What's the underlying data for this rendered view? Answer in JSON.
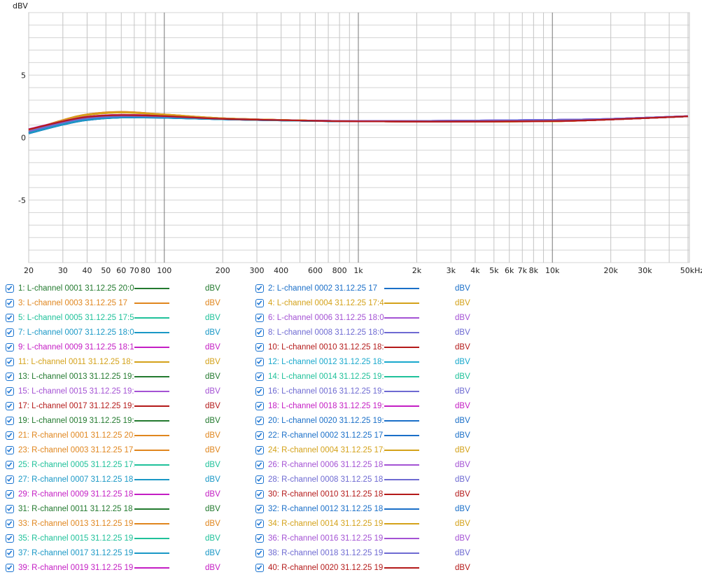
{
  "chart_data": {
    "type": "line",
    "ylabel": "dBV",
    "xunit": "Hz",
    "xscale": "log",
    "xlim": [
      20,
      50000
    ],
    "ylim": [
      -10,
      10
    ],
    "grid": true,
    "x_tick_labels": [
      [
        "20",
        20
      ],
      [
        "30",
        30
      ],
      [
        "40",
        40
      ],
      [
        "50",
        50
      ],
      [
        "60",
        60
      ],
      [
        "70",
        70
      ],
      [
        "80",
        80
      ],
      [
        "100",
        100
      ],
      [
        "200",
        200
      ],
      [
        "300",
        300
      ],
      [
        "400",
        400
      ],
      [
        "600",
        600
      ],
      [
        "800",
        800
      ],
      [
        "1k",
        1000
      ],
      [
        "2k",
        2000
      ],
      [
        "3k",
        3000
      ],
      [
        "4k",
        4000
      ],
      [
        "5k",
        5000
      ],
      [
        "6k",
        6000
      ],
      [
        "7k",
        7000
      ],
      [
        "8k",
        8000
      ],
      [
        "10k",
        10000
      ],
      [
        "20k",
        20000
      ],
      [
        "30k",
        30000
      ],
      [
        "50kHz",
        50000
      ]
    ],
    "y_tick_labels": [
      [
        "5",
        5
      ],
      [
        "0",
        0
      ],
      [
        "-5",
        -5
      ]
    ],
    "x": [
      20,
      30,
      40,
      60,
      100,
      200,
      500,
      1000,
      3000,
      10000,
      20000,
      50000
    ],
    "series": [
      {
        "name": "1: L-channel 0001 31.12.25 20:0",
        "unit": "dBV",
        "color": "#237a2f",
        "values": [
          0.35,
          1.05,
          1.42,
          1.62,
          1.6,
          1.47,
          1.35,
          1.3,
          1.3,
          1.38,
          1.48,
          1.7
        ]
      },
      {
        "name": "2: L-channel 0002 31.12.25 17",
        "unit": "dBV",
        "color": "#1a6fc8",
        "values": [
          0.33,
          1.03,
          1.4,
          1.6,
          1.58,
          1.46,
          1.35,
          1.3,
          1.31,
          1.39,
          1.48,
          1.7
        ]
      },
      {
        "name": "3: L-channel 0003 31.12.25 17",
        "unit": "dBV",
        "color": "#e0861e",
        "values": [
          0.55,
          1.4,
          1.85,
          2.05,
          1.85,
          1.55,
          1.38,
          1.3,
          1.28,
          1.3,
          1.45,
          1.7
        ]
      },
      {
        "name": "4: L-channel 0004 31.12.25 17:4",
        "unit": "dBV",
        "color": "#d4a21a",
        "values": [
          0.52,
          1.37,
          1.8,
          2.0,
          1.82,
          1.54,
          1.38,
          1.3,
          1.28,
          1.31,
          1.45,
          1.7
        ]
      },
      {
        "name": "5: L-channel 0005 31.12.25 17:5",
        "unit": "dBV",
        "color": "#1fc19a",
        "values": [
          0.36,
          1.06,
          1.43,
          1.63,
          1.61,
          1.47,
          1.35,
          1.3,
          1.3,
          1.38,
          1.48,
          1.7
        ]
      },
      {
        "name": "6: L-channel 0006 31.12.25 18:0",
        "unit": "dBV",
        "color": "#a452d4",
        "values": [
          0.5,
          1.2,
          1.55,
          1.72,
          1.68,
          1.5,
          1.37,
          1.32,
          1.35,
          1.42,
          1.5,
          1.72
        ]
      },
      {
        "name": "7: L-channel 0007 31.12.25 18:0",
        "unit": "dBV",
        "color": "#1a98c6",
        "values": [
          0.34,
          1.04,
          1.41,
          1.61,
          1.59,
          1.46,
          1.35,
          1.3,
          1.3,
          1.38,
          1.48,
          1.7
        ]
      },
      {
        "name": "8: L-channel 0008 31.12.25 18:0",
        "unit": "dBV",
        "color": "#6e6ad2",
        "values": [
          0.48,
          1.18,
          1.53,
          1.7,
          1.67,
          1.5,
          1.37,
          1.32,
          1.35,
          1.42,
          1.5,
          1.72
        ]
      },
      {
        "name": "9: L-channel 0009 31.12.25 18:1",
        "unit": "dBV",
        "color": "#c41ec4",
        "values": [
          0.67,
          1.32,
          1.67,
          1.82,
          1.73,
          1.5,
          1.37,
          1.3,
          1.28,
          1.32,
          1.45,
          1.7
        ]
      },
      {
        "name": "10: L-channel 0010 31.12.25 18:",
        "unit": "dBV",
        "color": "#b41a1a",
        "values": [
          0.65,
          1.3,
          1.65,
          1.8,
          1.72,
          1.5,
          1.37,
          1.3,
          1.28,
          1.32,
          1.45,
          1.7
        ]
      },
      {
        "name": "11: L-channel 0011 31.12.25 18:",
        "unit": "dBV",
        "color": "#d4a21a",
        "values": [
          0.53,
          1.38,
          1.82,
          2.02,
          1.83,
          1.54,
          1.38,
          1.3,
          1.28,
          1.31,
          1.45,
          1.7
        ]
      },
      {
        "name": "12: L-channel 0012 31.12.25 18:",
        "unit": "dBV",
        "color": "#18a8cc",
        "values": [
          0.35,
          1.05,
          1.42,
          1.62,
          1.6,
          1.47,
          1.35,
          1.3,
          1.3,
          1.38,
          1.48,
          1.7
        ]
      },
      {
        "name": "13: L-channel 0013 31.12.25 19:",
        "unit": "dBV",
        "color": "#237a2f",
        "values": [
          0.37,
          1.07,
          1.44,
          1.63,
          1.61,
          1.47,
          1.35,
          1.3,
          1.3,
          1.38,
          1.48,
          1.7
        ]
      },
      {
        "name": "14: L-channel 0014 31.12.25 19:",
        "unit": "dBV",
        "color": "#1fc19a",
        "values": [
          0.36,
          1.06,
          1.43,
          1.62,
          1.6,
          1.47,
          1.35,
          1.3,
          1.3,
          1.38,
          1.48,
          1.7
        ]
      },
      {
        "name": "15: L-channel 0015 31.12.25 19:",
        "unit": "dBV",
        "color": "#a452d4",
        "values": [
          0.5,
          1.2,
          1.55,
          1.72,
          1.68,
          1.5,
          1.37,
          1.32,
          1.35,
          1.42,
          1.5,
          1.72
        ]
      },
      {
        "name": "16: L-channel 0016 31.12.25 19:",
        "unit": "dBV",
        "color": "#6e6ad2",
        "values": [
          0.49,
          1.19,
          1.54,
          1.71,
          1.67,
          1.5,
          1.37,
          1.32,
          1.35,
          1.42,
          1.5,
          1.72
        ]
      },
      {
        "name": "17: L-channel 0017 31.12.25 19:",
        "unit": "dBV",
        "color": "#b41a1a",
        "values": [
          0.64,
          1.29,
          1.64,
          1.79,
          1.71,
          1.5,
          1.37,
          1.3,
          1.28,
          1.32,
          1.45,
          1.7
        ]
      },
      {
        "name": "18: L-channel 0018 31.12.25 19:",
        "unit": "dBV",
        "color": "#c41ec4",
        "values": [
          0.66,
          1.31,
          1.66,
          1.81,
          1.72,
          1.5,
          1.37,
          1.3,
          1.28,
          1.32,
          1.45,
          1.7
        ]
      },
      {
        "name": "19: L-channel 0019 31.12.25 19:",
        "unit": "dBV",
        "color": "#237a2f",
        "values": [
          0.36,
          1.06,
          1.43,
          1.62,
          1.6,
          1.47,
          1.35,
          1.3,
          1.3,
          1.38,
          1.48,
          1.7
        ]
      },
      {
        "name": "20: L-channel 0020 31.12.25 19:",
        "unit": "dBV",
        "color": "#1a6fc8",
        "values": [
          0.34,
          1.04,
          1.41,
          1.61,
          1.59,
          1.46,
          1.35,
          1.3,
          1.31,
          1.39,
          1.48,
          1.7
        ]
      },
      {
        "name": "21: R-channel 0001 31.12.25 20:",
        "unit": "dBV",
        "color": "#e0861e",
        "values": [
          0.56,
          1.41,
          1.86,
          2.06,
          1.86,
          1.55,
          1.38,
          1.3,
          1.28,
          1.3,
          1.45,
          1.7
        ]
      },
      {
        "name": "22: R-channel 0002 31.12.25 17",
        "unit": "dBV",
        "color": "#1a6fc8",
        "values": [
          0.33,
          1.03,
          1.4,
          1.6,
          1.58,
          1.46,
          1.35,
          1.3,
          1.31,
          1.39,
          1.48,
          1.7
        ]
      },
      {
        "name": "23: R-channel 0003 31.12.25 17",
        "unit": "dBV",
        "color": "#e0861e",
        "values": [
          0.55,
          1.4,
          1.85,
          2.05,
          1.85,
          1.55,
          1.38,
          1.3,
          1.28,
          1.3,
          1.45,
          1.7
        ]
      },
      {
        "name": "24: R-channel 0004 31.12.25 17:",
        "unit": "dBV",
        "color": "#d4a21a",
        "values": [
          0.52,
          1.37,
          1.8,
          2.0,
          1.82,
          1.54,
          1.38,
          1.3,
          1.28,
          1.31,
          1.45,
          1.7
        ]
      },
      {
        "name": "25: R-channel 0005 31.12.25 17:",
        "unit": "dBV",
        "color": "#1fc19a",
        "values": [
          0.36,
          1.06,
          1.43,
          1.63,
          1.61,
          1.47,
          1.35,
          1.3,
          1.3,
          1.38,
          1.48,
          1.7
        ]
      },
      {
        "name": "26: R-channel 0006 31.12.25 18",
        "unit": "dBV",
        "color": "#a452d4",
        "values": [
          0.5,
          1.2,
          1.55,
          1.72,
          1.68,
          1.5,
          1.37,
          1.32,
          1.35,
          1.42,
          1.5,
          1.72
        ]
      },
      {
        "name": "27: R-channel 0007 31.12.25 18",
        "unit": "dBV",
        "color": "#1a98c6",
        "values": [
          0.34,
          1.04,
          1.41,
          1.61,
          1.59,
          1.46,
          1.35,
          1.3,
          1.3,
          1.38,
          1.48,
          1.7
        ]
      },
      {
        "name": "28: R-channel 0008 31.12.25 18",
        "unit": "dBV",
        "color": "#6e6ad2",
        "values": [
          0.48,
          1.18,
          1.53,
          1.7,
          1.67,
          1.5,
          1.37,
          1.32,
          1.35,
          1.42,
          1.5,
          1.72
        ]
      },
      {
        "name": "29: R-channel 0009 31.12.25 18",
        "unit": "dBV",
        "color": "#c41ec4",
        "values": [
          0.67,
          1.32,
          1.67,
          1.82,
          1.73,
          1.5,
          1.37,
          1.3,
          1.28,
          1.32,
          1.45,
          1.7
        ]
      },
      {
        "name": "30: R-channel 0010 31.12.25 18",
        "unit": "dBV",
        "color": "#b41a1a",
        "values": [
          0.65,
          1.3,
          1.65,
          1.8,
          1.72,
          1.5,
          1.37,
          1.3,
          1.28,
          1.32,
          1.45,
          1.7
        ]
      },
      {
        "name": "31: R-channel 0011 31.12.25 18",
        "unit": "dBV",
        "color": "#237a2f",
        "values": [
          0.35,
          1.05,
          1.42,
          1.62,
          1.6,
          1.47,
          1.35,
          1.3,
          1.3,
          1.38,
          1.48,
          1.7
        ]
      },
      {
        "name": "32: R-channel 0012 31.12.25 18",
        "unit": "dBV",
        "color": "#1a6fc8",
        "values": [
          0.34,
          1.04,
          1.41,
          1.61,
          1.59,
          1.46,
          1.35,
          1.3,
          1.31,
          1.39,
          1.48,
          1.7
        ]
      },
      {
        "name": "33: R-channel 0013 31.12.25 19",
        "unit": "dBV",
        "color": "#e0861e",
        "values": [
          0.54,
          1.39,
          1.84,
          2.04,
          1.84,
          1.55,
          1.38,
          1.3,
          1.28,
          1.3,
          1.45,
          1.7
        ]
      },
      {
        "name": "34: R-channel 0014 31.12.25 19",
        "unit": "dBV",
        "color": "#d4a21a",
        "values": [
          0.53,
          1.38,
          1.82,
          2.02,
          1.83,
          1.54,
          1.38,
          1.3,
          1.28,
          1.31,
          1.45,
          1.7
        ]
      },
      {
        "name": "35: R-channel 0015 31.12.25 19",
        "unit": "dBV",
        "color": "#1fc19a",
        "values": [
          0.36,
          1.06,
          1.43,
          1.62,
          1.6,
          1.47,
          1.35,
          1.3,
          1.3,
          1.38,
          1.48,
          1.7
        ]
      },
      {
        "name": "36: R-channel 0016 31.12.25 19",
        "unit": "dBV",
        "color": "#a452d4",
        "values": [
          0.5,
          1.2,
          1.55,
          1.72,
          1.68,
          1.5,
          1.37,
          1.32,
          1.35,
          1.42,
          1.5,
          1.72
        ]
      },
      {
        "name": "37: R-channel 0017 31.12.25 19",
        "unit": "dBV",
        "color": "#1a98c6",
        "values": [
          0.35,
          1.05,
          1.42,
          1.62,
          1.6,
          1.47,
          1.35,
          1.3,
          1.3,
          1.38,
          1.48,
          1.7
        ]
      },
      {
        "name": "38: R-channel 0018 31.12.25 19",
        "unit": "dBV",
        "color": "#6e6ad2",
        "values": [
          0.49,
          1.19,
          1.54,
          1.71,
          1.67,
          1.5,
          1.37,
          1.32,
          1.35,
          1.42,
          1.5,
          1.72
        ]
      },
      {
        "name": "39: R-channel 0019 31.12.25 19",
        "unit": "dBV",
        "color": "#c41ec4",
        "values": [
          0.66,
          1.31,
          1.66,
          1.81,
          1.72,
          1.5,
          1.37,
          1.3,
          1.28,
          1.32,
          1.45,
          1.7
        ]
      },
      {
        "name": "40: R-channel 0020 31.12.25 19",
        "unit": "dBV",
        "color": "#b41a1a",
        "values": [
          0.65,
          1.3,
          1.65,
          1.8,
          1.72,
          1.5,
          1.37,
          1.3,
          1.28,
          1.32,
          1.45,
          1.7
        ]
      }
    ]
  }
}
